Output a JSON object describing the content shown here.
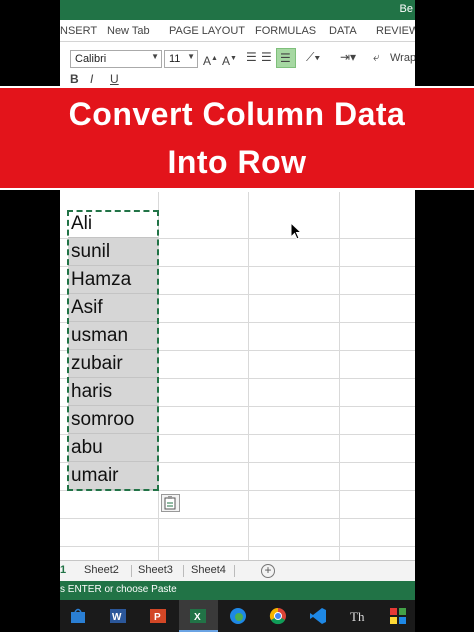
{
  "window": {
    "title_fragment": "Be"
  },
  "ribbon": {
    "tabs": [
      "NSERT",
      "New Tab",
      "PAGE LAYOUT",
      "FORMULAS",
      "DATA",
      "REVIEW"
    ],
    "font_name": "Calibri",
    "font_size": "11",
    "wrap_label": "Wrap"
  },
  "banner": {
    "line1": "Convert Column Data",
    "line2": "Into Row",
    "background": "#e3141b"
  },
  "cells": [
    "Ali",
    "sunil",
    "Hamza",
    "Asif",
    "usman",
    "zubair",
    "haris",
    "somroo",
    "abu",
    "umair"
  ],
  "sheets": {
    "partial_first": "1",
    "tabs": [
      "Sheet2",
      "Sheet3",
      "Sheet4"
    ],
    "add_symbol": "+"
  },
  "status": {
    "text": "s ENTER or choose Paste"
  },
  "taskbar": {
    "icons": [
      "windows-store-icon",
      "word-icon",
      "powerpoint-icon",
      "excel-icon",
      "edge-icon",
      "chrome-icon",
      "vscode-icon",
      "typora-icon",
      "app-grid-icon"
    ]
  },
  "colors": {
    "excel_green": "#217346",
    "selection_gray": "#d6d6d6"
  }
}
